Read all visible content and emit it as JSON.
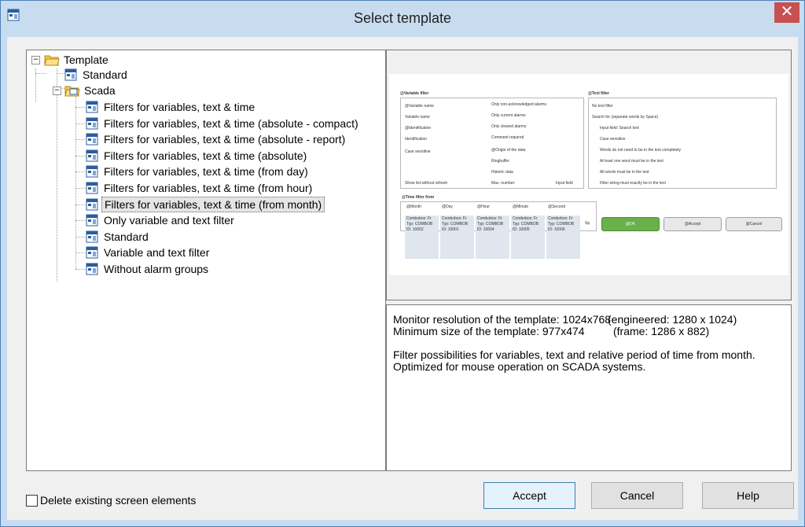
{
  "window": {
    "title": "Select template",
    "close_glyph": "✕"
  },
  "tree": {
    "root": {
      "label": "Template",
      "expander": "−"
    },
    "standard_top": {
      "label": "Standard"
    },
    "scada": {
      "label": "Scada",
      "expander": "−"
    },
    "items": [
      {
        "label": "Filters for variables, text & time"
      },
      {
        "label": "Filters for variables, text & time (absolute - compact)"
      },
      {
        "label": "Filters for variables, text & time (absolute - report)"
      },
      {
        "label": "Filters for variables, text & time (absolute)"
      },
      {
        "label": "Filters for variables, text & time (from day)"
      },
      {
        "label": "Filters for variables, text & time (from hour)"
      },
      {
        "label": "Filters for variables, text & time (from month)",
        "selected": true
      },
      {
        "label": "Only variable and text filter"
      },
      {
        "label": "Standard"
      },
      {
        "label": "Variable and text filter"
      },
      {
        "label": "Without alarm groups"
      }
    ]
  },
  "preview": {
    "variable_filter_title": "@Variable filter",
    "var_left": [
      "@Variable name",
      "Variable name",
      "@Identification",
      "Identification",
      "Case sensitive",
      "Show list without refresh"
    ],
    "var_right": [
      "Only non-acknowledged alarms",
      "Only current alarms",
      "Only cleared alarms",
      "Comment required",
      "@Origin of the data",
      "Ringbuffer",
      "Historic data"
    ],
    "max_number": "Max. number:",
    "input_field": "Input field",
    "text_filter_title": "@Text filter",
    "text_items": [
      "No text filter",
      "Search for (separate words by Space)",
      "Input field: Search text",
      "Case sensitive",
      "Words do not need to be in the text completely",
      "At least one word must be in the text",
      "All words must be in the text",
      "Filter string must exactly be in the text"
    ],
    "time_filter_title": "@Time filter from",
    "time_cols": [
      {
        "h": "@Month",
        "t": "Combobox: Fr",
        "ty": "Typ: COMBOB",
        "id": "ID: 10002"
      },
      {
        "h": "@Day",
        "t": "Combobox: Fr",
        "ty": "Typ: COMBOB",
        "id": "ID: 10001"
      },
      {
        "h": "@Hour",
        "t": "Combobox: Fr",
        "ty": "Typ: COMBOB",
        "id": "ID: 10004"
      },
      {
        "h": "@Minute",
        "t": "Combobox: Fr",
        "ty": "Typ: COMBOB",
        "id": "ID: 10005"
      },
      {
        "h": "@Second",
        "t": "Combobox: Fr",
        "ty": "Typ: COMBOB",
        "id": "ID: 10006"
      }
    ],
    "sp": "Sp",
    "btn_ok": "@OK",
    "btn_accept": "@Accept",
    "btn_cancel": "@Cancel",
    "ok_color": "#6ab04c"
  },
  "description": {
    "res_left": "Monitor resolution of the template: 1024x768",
    "res_right": "(engineered: 1280 x 1024)",
    "min_left": "Minimum size of the template: 977x474",
    "min_right": "(frame: 1286 x 882)",
    "line1": "Filter possibilities for variables, text and relative period of time from month.",
    "line2": "Optimized for mouse operation on SCADA systems."
  },
  "checkbox": {
    "label": "Delete existing screen elements",
    "checked": false
  },
  "buttons": {
    "accept": "Accept",
    "cancel": "Cancel",
    "help": "Help"
  },
  "colors": {
    "titlebar": "#c8dcf0",
    "close": "#c75050",
    "folder": "#f5c842"
  }
}
